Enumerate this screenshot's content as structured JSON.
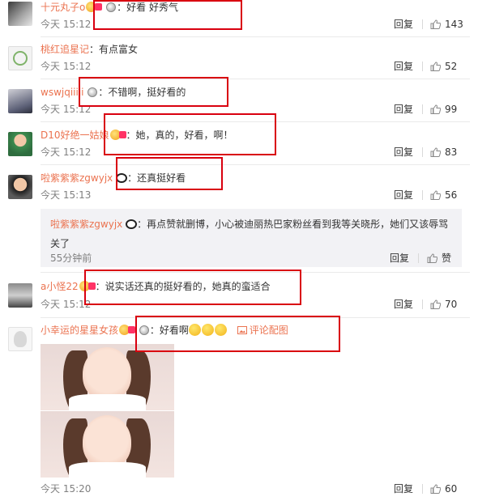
{
  "comments": [
    {
      "user": "十元丸子o",
      "text": "：好看 好秀气",
      "time": "今天 15:12",
      "reply": "回复",
      "likes": "143"
    },
    {
      "user": "桃红追星记",
      "text": "：有点富女",
      "time": "今天 15:12",
      "reply": "回复",
      "likes": "52"
    },
    {
      "user": "wswjqiiiii",
      "text": "：不错啊，挺好看的",
      "time": "今天 15:12",
      "reply": "回复",
      "likes": "99"
    },
    {
      "user": "D10好绝一姑娘",
      "text": "：她，真的，好看，啊！",
      "time": "今天 15:12",
      "reply": "回复",
      "likes": "83"
    },
    {
      "user": "啦紫紫紫zgwyjx",
      "text": "：还真挺好看",
      "time": "今天 15:13",
      "reply": "回复",
      "likes": "56"
    },
    {
      "user": "a小怪22",
      "text": "：说实话还真的挺好看的，她真的蛮适合",
      "time": "今天 15:12",
      "reply": "回复",
      "likes": "70"
    },
    {
      "user": "小幸运的星星女孩",
      "text": "：好看啊",
      "time": "今天 15:20",
      "reply": "回复",
      "likes": "60",
      "pic_link": "评论配图"
    }
  ],
  "subreply": {
    "user": "啦紫紫紫zgwyjx",
    "text": "：再点赞就删博，小心被迪丽热巴家粉丝看到我等关晓彤，她们又该辱骂关了",
    "time": "55分钟前",
    "reply": "回复",
    "like_label": "赞"
  },
  "icons": {
    "like": "thumbs-up-icon",
    "picture": "image-icon",
    "badge": "member-badge-icon",
    "emoji": "smile-emoji-icon",
    "panda": "panda-emoji-icon"
  },
  "colors": {
    "username": "#eb7350",
    "highlight_box": "#d9000f",
    "subreply_bg": "#f2f2f5"
  }
}
